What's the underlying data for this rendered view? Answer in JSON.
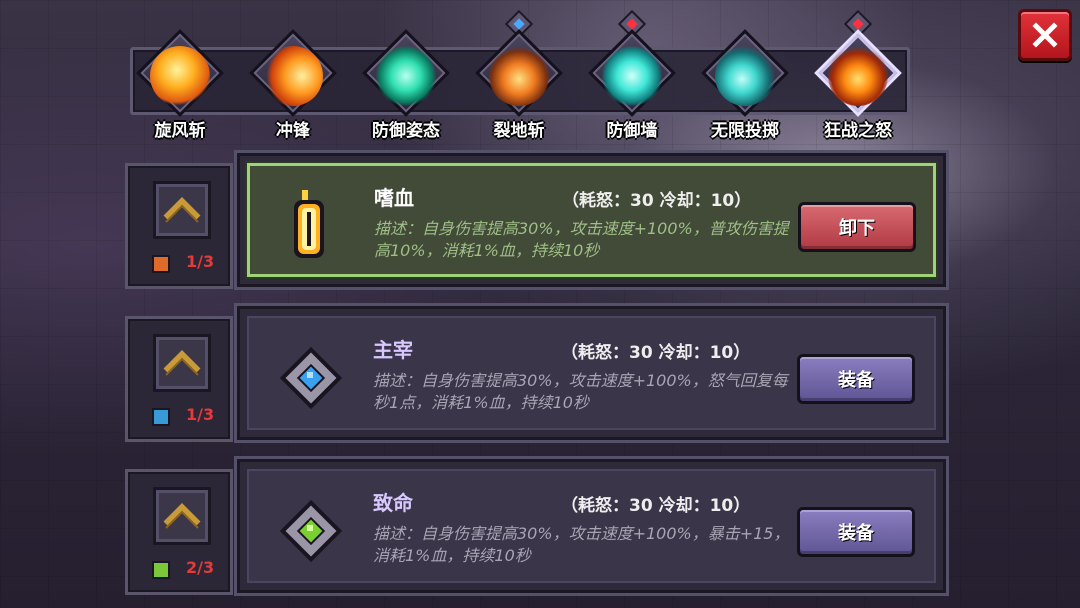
{
  "skills": [
    {
      "label": "旋风斩",
      "gem": ""
    },
    {
      "label": "冲锋",
      "gem": ""
    },
    {
      "label": "防御姿态",
      "gem": ""
    },
    {
      "label": "裂地斩",
      "gem": "blue"
    },
    {
      "label": "防御墙",
      "gem": "red"
    },
    {
      "label": "无限投掷",
      "gem": ""
    },
    {
      "label": "狂战之怒",
      "gem": "red"
    }
  ],
  "close_icon": "close-icon",
  "talents": [
    {
      "name": "嗜血",
      "cost": "（耗怒：30  冷却：10）",
      "desc": "描述：自身伤害提高30%，攻击速度+100%，普攻伤害提高10%，消耗1%血，持续10秒",
      "button": "卸下",
      "level": "1/3",
      "equipped": true
    },
    {
      "name": "主宰",
      "cost": "（耗怒：30  冷却：10）",
      "desc": "描述：自身伤害提高30%，攻击速度+100%，怒气回复每秒1点，消耗1%血，持续10秒",
      "button": "装备",
      "level": "1/3",
      "equipped": false
    },
    {
      "name": "致命",
      "cost": "（耗怒：30  冷却：10）",
      "desc": "描述：自身伤害提高30%，攻击速度+100%，暴击+15，消耗1%血，持续10秒",
      "button": "装备",
      "level": "2/3",
      "equipped": false
    }
  ],
  "colors": {
    "active_border": "#9ed37a",
    "unequip_button": "#c9535c",
    "equip_button": "#7468ac",
    "level_text": "#e43a3a"
  }
}
